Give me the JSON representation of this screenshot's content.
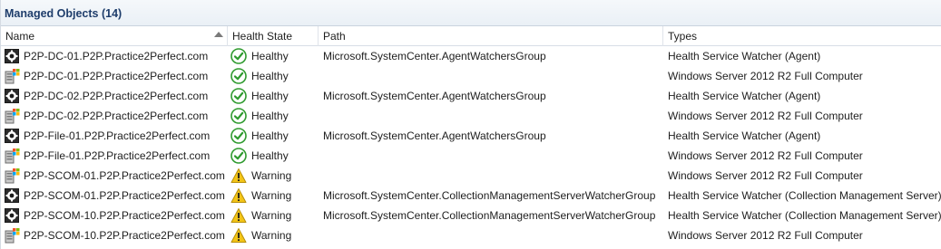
{
  "panel": {
    "title": "Managed Objects (14)"
  },
  "columns": {
    "name": "Name",
    "health": "Health State",
    "path": "Path",
    "types": "Types"
  },
  "rows": [
    {
      "name": "P2P-DC-01.P2P.Practice2Perfect.com",
      "icon": "health-service-watcher-icon",
      "health": "Healthy",
      "health_icon": "healthy-check-icon",
      "path": "Microsoft.SystemCenter.AgentWatchersGroup",
      "types": "Health Service Watcher (Agent)"
    },
    {
      "name": "P2P-DC-01.P2P.Practice2Perfect.com",
      "icon": "windows-computer-icon",
      "health": "Healthy",
      "health_icon": "healthy-check-icon",
      "path": "",
      "types": "Windows Server 2012 R2 Full Computer"
    },
    {
      "name": "P2P-DC-02.P2P.Practice2Perfect.com",
      "icon": "health-service-watcher-icon",
      "health": "Healthy",
      "health_icon": "healthy-check-icon",
      "path": "Microsoft.SystemCenter.AgentWatchersGroup",
      "types": "Health Service Watcher (Agent)"
    },
    {
      "name": "P2P-DC-02.P2P.Practice2Perfect.com",
      "icon": "windows-computer-icon",
      "health": "Healthy",
      "health_icon": "healthy-check-icon",
      "path": "",
      "types": "Windows Server 2012 R2 Full Computer"
    },
    {
      "name": "P2P-File-01.P2P.Practice2Perfect.com",
      "icon": "health-service-watcher-icon",
      "health": "Healthy",
      "health_icon": "healthy-check-icon",
      "path": "Microsoft.SystemCenter.AgentWatchersGroup",
      "types": "Health Service Watcher (Agent)"
    },
    {
      "name": "P2P-File-01.P2P.Practice2Perfect.com",
      "icon": "windows-computer-icon",
      "health": "Healthy",
      "health_icon": "healthy-check-icon",
      "path": "",
      "types": "Windows Server 2012 R2 Full Computer"
    },
    {
      "name": "P2P-SCOM-01.P2P.Practice2Perfect.com",
      "icon": "windows-computer-icon",
      "health": "Warning",
      "health_icon": "warning-triangle-icon",
      "path": "",
      "types": "Windows Server 2012 R2 Full Computer"
    },
    {
      "name": "P2P-SCOM-01.P2P.Practice2Perfect.com",
      "icon": "health-service-watcher-icon",
      "health": "Warning",
      "health_icon": "warning-triangle-icon",
      "path": "Microsoft.SystemCenter.CollectionManagementServerWatcherGroup",
      "types": "Health Service Watcher (Collection Management Server)"
    },
    {
      "name": "P2P-SCOM-10.P2P.Practice2Perfect.com",
      "icon": "health-service-watcher-icon",
      "health": "Warning",
      "health_icon": "warning-triangle-icon",
      "path": "Microsoft.SystemCenter.CollectionManagementServerWatcherGroup",
      "types": "Health Service Watcher (Collection Management Server)"
    },
    {
      "name": "P2P-SCOM-10.P2P.Practice2Perfect.com",
      "icon": "windows-computer-icon",
      "health": "Warning",
      "health_icon": "warning-triangle-icon",
      "path": "",
      "types": "Windows Server 2012 R2 Full Computer"
    }
  ],
  "colors": {
    "title": "#1e3d6b",
    "healthy": "#2e9a2e",
    "warning": "#f2c417"
  }
}
